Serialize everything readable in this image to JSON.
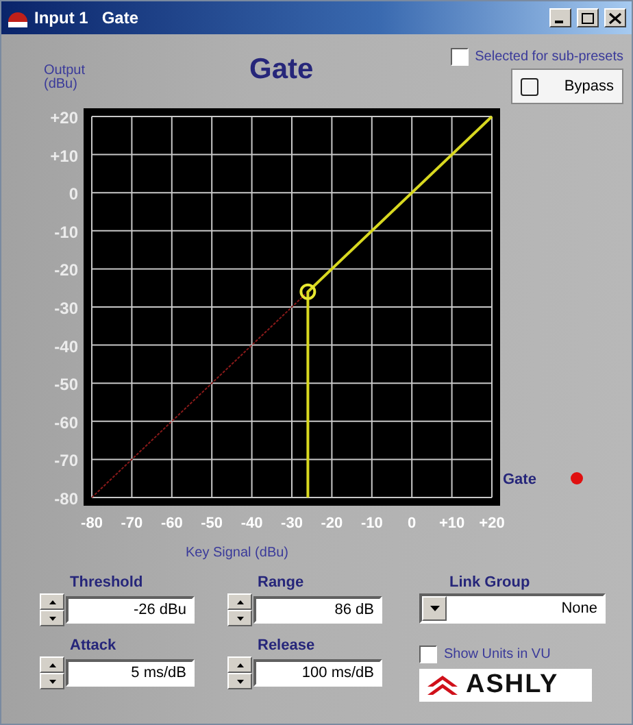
{
  "window": {
    "title": "Input 1   Gate"
  },
  "header": {
    "title": "Gate"
  },
  "selected_for_subpresets": {
    "label": "Selected for sub-presets",
    "checked": false
  },
  "bypass": {
    "label": "Bypass",
    "on": false
  },
  "chart": {
    "chart_data": {
      "type": "line",
      "xlabel": "Key Signal (dBu)",
      "ylabel": "Output (dBu)",
      "x": [
        -80,
        -26,
        -26,
        20
      ],
      "grid": true,
      "series": [
        {
          "color": "#8a1a1a",
          "line_style": "dashed",
          "values": [
            -80,
            -26,
            null,
            null
          ]
        },
        {
          "color": "#d8d820",
          "line_style": "solid",
          "values": [
            null,
            -80,
            -26,
            20
          ]
        }
      ],
      "xlim": [
        -80,
        20
      ],
      "ylim": [
        -80,
        20
      ],
      "xticks": [
        -80,
        -70,
        -60,
        -50,
        -40,
        -30,
        -20,
        -10,
        0,
        {
          "value": 10,
          "label": "+10"
        },
        {
          "value": 20,
          "label": "+20"
        }
      ],
      "yticks": [
        {
          "value": 20,
          "label": "+20"
        },
        {
          "value": 10,
          "label": "+10"
        },
        0,
        -10,
        -20,
        -30,
        -40,
        -50,
        -60,
        -70,
        -80
      ]
    }
  },
  "gate_indicator": {
    "label": "Gate",
    "on": true
  },
  "controls": [
    {
      "label": "Threshold",
      "value": "-26 dBu"
    },
    {
      "label": "Range",
      "value": "86 dB"
    },
    {
      "label": "Attack",
      "value": "5 ms/dB"
    },
    {
      "label": "Release",
      "value": "100 ms/dB"
    }
  ],
  "link_group": {
    "label": "Link Group",
    "value": "None"
  },
  "show_units_vu": {
    "label": "Show Units in VU",
    "checked": false
  },
  "logo": {
    "text": "ASHLY"
  }
}
